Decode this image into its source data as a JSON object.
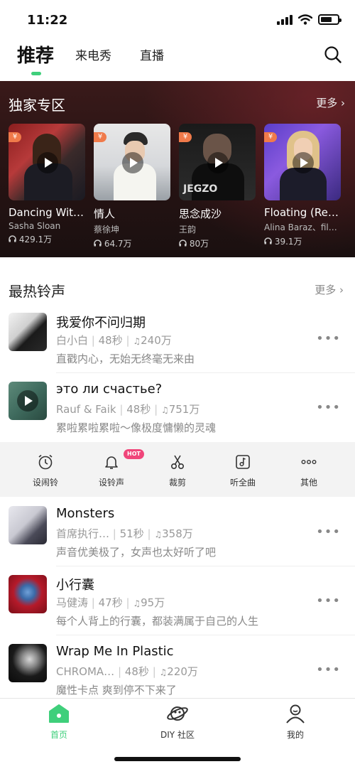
{
  "status": {
    "time": "11:22",
    "battery_level": 0.7
  },
  "tabs": {
    "active": "推荐",
    "items": [
      "来电秀",
      "直播"
    ]
  },
  "exclusive": {
    "title": "独家专区",
    "more": "更多 ›",
    "badge": "¥",
    "cards": [
      {
        "title": "Dancing With Your Ghost",
        "artist": "Sasha Sloan",
        "plays": "429.1万"
      },
      {
        "title": "情人",
        "artist": "蔡徐坤",
        "plays": "64.7万"
      },
      {
        "title": "思念成沙",
        "artist": "王韵",
        "plays": "80万"
      },
      {
        "title": "Floating (Remix)",
        "artist": "Alina Baraz、filous",
        "plays": "39.1万"
      }
    ]
  },
  "hot": {
    "title": "最热铃声",
    "more": "更多 ›",
    "rows": [
      {
        "title": "我爱你不问归期",
        "artist": "白小白",
        "duration": "48秒",
        "plays": "240万",
        "desc": "直戳内心，无始无终毫无来由"
      },
      {
        "title": "это ли счастье?",
        "artist": "Rauf & Faik",
        "duration": "48秒",
        "plays": "751万",
        "desc": "累啦累啦累啦～像极度慵懒的灵魂"
      },
      {
        "title": "Monsters",
        "artist": "首席执行…",
        "duration": "51秒",
        "plays": "358万",
        "desc": "声音优美极了，女声也太好听了吧"
      },
      {
        "title": "小行囊",
        "artist": "马健涛",
        "duration": "47秒",
        "plays": "95万",
        "desc": "每个人背上的行囊，都装满属于自己的人生"
      },
      {
        "title": "Wrap Me In Plastic",
        "artist": "CHROMA…",
        "duration": "48秒",
        "plays": "220万",
        "desc": "魔性卡点 爽到停不下来了"
      }
    ]
  },
  "actions": {
    "items": [
      "设闹铃",
      "设铃声",
      "裁剪",
      "听全曲",
      "其他"
    ],
    "hot_badge": "HOT"
  },
  "nav": {
    "items": [
      "首页",
      "DIY 社区",
      "我的"
    ],
    "active": "首页"
  },
  "colors": {
    "accent": "#3fcf7b",
    "badge": "#f07a4a",
    "hot": "#f0457a"
  }
}
